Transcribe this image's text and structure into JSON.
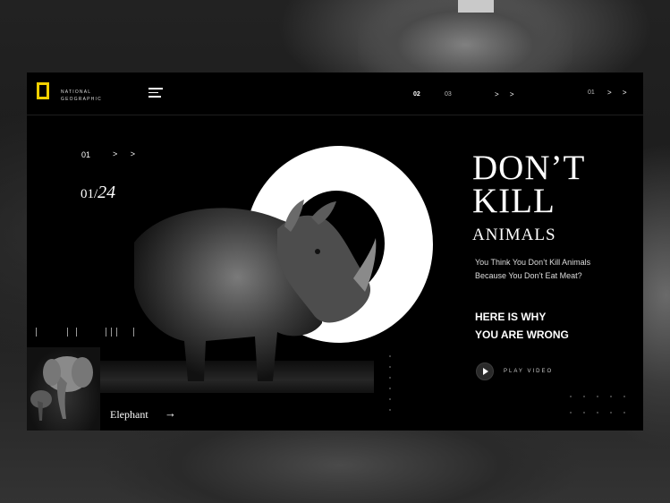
{
  "brand": {
    "name_line1": "NATIONAL",
    "name_line2": "GEOGRAPHIC",
    "accent": "#f2d000"
  },
  "topnav": {
    "pages": [
      "02",
      "03"
    ],
    "active_page": "02",
    "mid_arrows": "> >",
    "right_page": "01",
    "right_arrows": "> >"
  },
  "slider": {
    "current": "01",
    "arrows": "> >",
    "counter_current": "01/",
    "counter_total": "24"
  },
  "thumbnail": {
    "label": "Elephant",
    "arrow": "→"
  },
  "hero": {
    "headline_line1": "DON’T",
    "headline_line2": "KILL",
    "subheadline": "ANIMALS",
    "paragraph": "You Think  You Don’t Kill Animals Because You Don’t Eat Meat?",
    "cta_line1": "HERE IS WHY",
    "cta_line2": "YOU ARE WRONG",
    "play_label": "PLAY VIDEO"
  },
  "icons": [
    "logo-frame-icon",
    "menu-icon",
    "play-icon",
    "arrow-right-icon"
  ]
}
